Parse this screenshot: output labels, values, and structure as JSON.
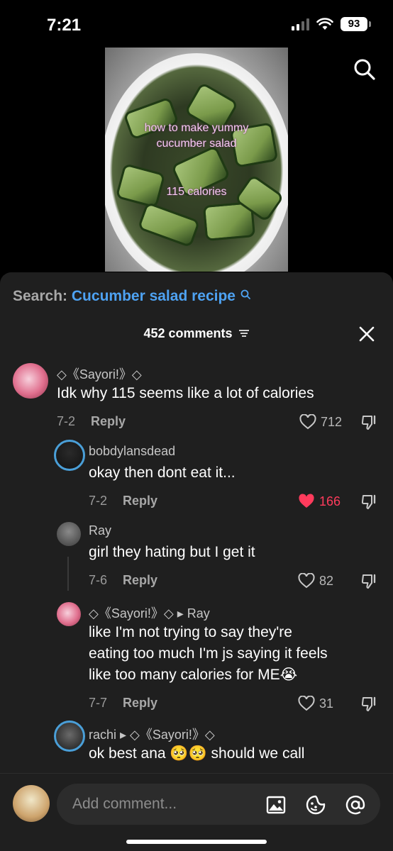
{
  "status_bar": {
    "time": "7:21",
    "battery": "93"
  },
  "video": {
    "caption_line1": "how to make yummy",
    "caption_line2": "cucumber salad",
    "caption_line3": "115 calories"
  },
  "search": {
    "label": "Search:",
    "query": "Cucumber salad recipe"
  },
  "comments_header": {
    "count_label": "452 comments"
  },
  "comments": [
    {
      "username": "◇《Sayori!》◇",
      "text": "Idk why 115 seems like a lot of calories",
      "date": "7-2",
      "reply": "Reply",
      "likes": "712",
      "liked": false
    },
    {
      "username": "bobdylansdead",
      "text": "okay then dont eat it...",
      "date": "7-2",
      "reply": "Reply",
      "likes": "166",
      "liked": true
    },
    {
      "username": "Ray",
      "text": "girl they hating but I get it",
      "date": "7-6",
      "reply": "Reply",
      "likes": "82",
      "liked": false
    },
    {
      "username": "◇《Sayori!》◇ ▸ Ray",
      "text_lines": [
        "like I'm not trying to say they're",
        "eating too much I'm js saying it feels",
        "like too many calories for ME😭"
      ],
      "date": "7-7",
      "reply": "Reply",
      "likes": "31",
      "liked": false
    },
    {
      "username": "rachi ▸ ◇《Sayori!》◇",
      "text": "ok best ana 🥺🥺 should we call"
    }
  ],
  "composer": {
    "placeholder": "Add comment..."
  }
}
